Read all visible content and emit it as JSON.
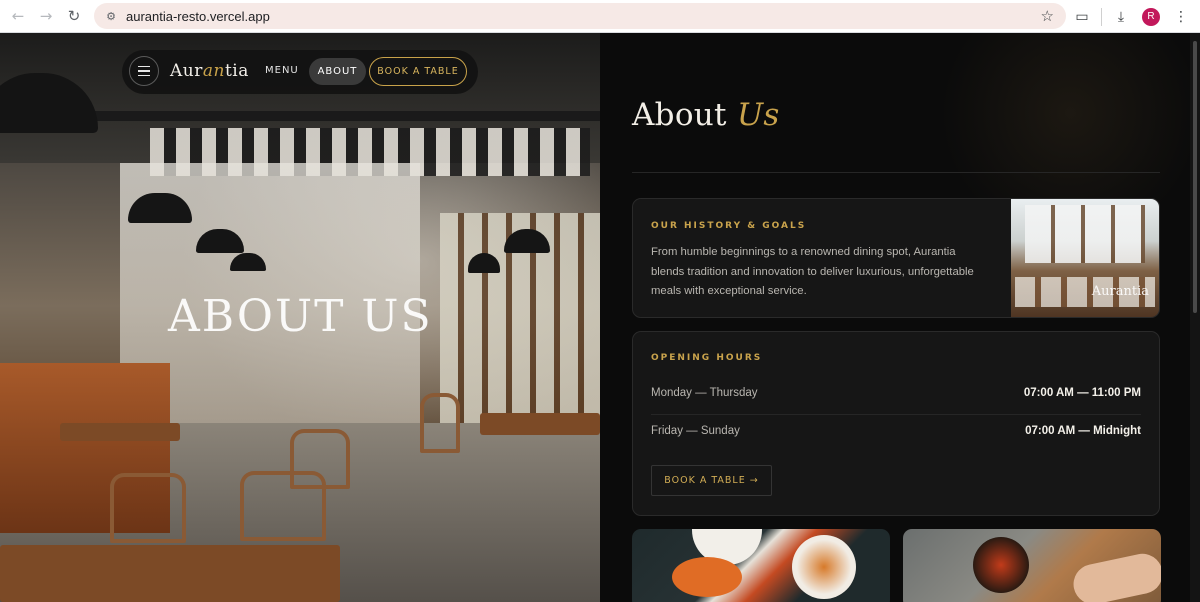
{
  "browser": {
    "url": "aurantia-resto.vercel.app",
    "profile_initial": "R"
  },
  "nav": {
    "brand_start": "Aur",
    "brand_accent": "an",
    "brand_end": "tia",
    "menu_label": "MENU",
    "about_label": "ABOUT",
    "book_label": "BOOK A TABLE"
  },
  "hero": {
    "title": "ABOUT US"
  },
  "page": {
    "heading_main": "About",
    "heading_accent": "Us"
  },
  "history": {
    "label": "OUR HISTORY & GOALS",
    "body": "From humble beginnings to a renowned dining spot, Aurantia blends tradition and innovation to deliver luxurious, unforgettable meals with exceptional service.",
    "image_watermark": "Aurantia"
  },
  "hours": {
    "label": "OPENING HOURS",
    "rows": [
      {
        "day": "Monday — Thursday",
        "time": "07:00 AM — 11:00 PM"
      },
      {
        "day": "Friday — Sunday",
        "time": "07:00 AM — Midnight"
      }
    ],
    "book_button": "BOOK A TABLE →"
  },
  "colors": {
    "accent_gold": "#c9a34c",
    "panel_bg": "#0b0b0b",
    "card_bg": "#161616"
  }
}
